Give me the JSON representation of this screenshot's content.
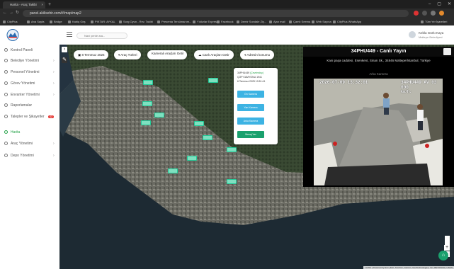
{
  "browser": {
    "tab_title": "Harita - Araç Takibi",
    "url": "panel.akilisehir.com/#/map/map2",
    "bookmarks": [
      "CityPlus",
      "Ana Sayfa",
      "Bridge",
      "Kabiq Girş",
      "PIKTAR: AYKAL",
      "Sorg Oyun - Rev. Takibi",
      "Presenta Tercümanım...",
      "Yıldızlar Express",
      "Facebook",
      "Demir Sondale Ziy...",
      "Ajan mail",
      "Çamlı Seema",
      "Web Sayına",
      "CityPlus WhatsApp",
      "Tüm Yer İşaretleri"
    ]
  },
  "header": {
    "search_placeholder": "Navi yerde ara...",
    "user_name": "Kebla Gürlü Kaya",
    "user_role": "Maltepe Belediyesi"
  },
  "sidebar": {
    "items": [
      {
        "label": "Kontrol Paneli",
        "chevron": "",
        "badge": ""
      },
      {
        "label": "Belediye Yönetimi",
        "chevron": "›",
        "badge": ""
      },
      {
        "label": "Personel Yönetimi",
        "chevron": "›",
        "badge": ""
      },
      {
        "label": "Görev Yönetimi",
        "chevron": "›",
        "badge": ""
      },
      {
        "label": "Envanter Yönetimi",
        "chevron": "›",
        "badge": ""
      },
      {
        "label": "Raporlamalar",
        "chevron": "",
        "badge": ""
      },
      {
        "label": "Talepler ve Şikayetler",
        "chevron": "",
        "badge": "42"
      },
      {
        "label": "Harita",
        "chevron": "",
        "badge": ""
      },
      {
        "label": "Araç Yönetimi",
        "chevron": "›",
        "badge": ""
      },
      {
        "label": "Depo Yönetimi",
        "chevron": "›",
        "badge": ""
      }
    ]
  },
  "map_toolbar": {
    "date": "8 Temmuz 2026",
    "vehicle_types": "Araç Türleri",
    "camera_vehicles": "Kameralı Araçları Getir",
    "live_tools": "Canlı Araçları Getir",
    "address_search": "Adresin konumu"
  },
  "popup": {
    "plate": "34PHU449",
    "status": "(Çevrimdışı)",
    "line2": "ÇÖP KAMYONU 1941",
    "line3": "6 Temmuz 2025 10:51:41",
    "buttons": [
      "Ön Kamera",
      "Yan Kamera",
      "Arka Kamera",
      "Mesaj Ver"
    ]
  },
  "camera": {
    "title": "34PHU449 - Canlı Yayın",
    "address": "Kani paşa caddesi, Esenkent, Sinan Sk., 34846 Maltepe/İstanbul, Türkiye",
    "subtitle": "Arka Kamera",
    "osd_time": "2026-07-09 13:32:01",
    "osd_plate": "34PHU449 AV 03",
    "osd_speed": "000",
    "osd_speed_unit": "km/h:"
  },
  "zoom": {
    "in": "+",
    "out": "−"
  },
  "attribution": "Leaflet | Powered by Esri | Esri, TomTom, Garmin, GeoTechnologies, Inc, METI/NASA, USGS",
  "colors": {
    "accent": "#27a34a",
    "popup_button": "#3db3e3",
    "popup_button_alt": "#1aa06d"
  }
}
